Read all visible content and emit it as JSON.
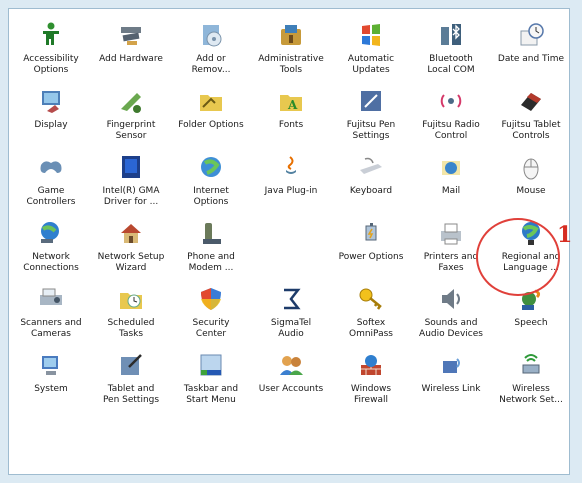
{
  "items": [
    {
      "label": "Accessibility\nOptions",
      "icon": "accessibility-icon"
    },
    {
      "label": "Add Hardware",
      "icon": "add-hardware-icon"
    },
    {
      "label": "Add or\nRemov...",
      "icon": "add-remove-programs-icon"
    },
    {
      "label": "Administrative\nTools",
      "icon": "administrative-tools-icon"
    },
    {
      "label": "Automatic\nUpdates",
      "icon": "automatic-updates-icon"
    },
    {
      "label": "Bluetooth\nLocal COM",
      "icon": "bluetooth-icon"
    },
    {
      "label": "Date and Time",
      "icon": "date-time-icon"
    },
    {
      "label": "Display",
      "icon": "display-icon"
    },
    {
      "label": "Fingerprint\nSensor",
      "icon": "fingerprint-sensor-icon"
    },
    {
      "label": "Folder Options",
      "icon": "folder-options-icon"
    },
    {
      "label": "Fonts",
      "icon": "fonts-icon"
    },
    {
      "label": "Fujitsu Pen\nSettings",
      "icon": "pen-settings-icon"
    },
    {
      "label": "Fujitsu Radio\nControl",
      "icon": "radio-control-icon"
    },
    {
      "label": "Fujitsu Tablet\nControls",
      "icon": "tablet-controls-icon"
    },
    {
      "label": "Game\nControllers",
      "icon": "game-controllers-icon"
    },
    {
      "label": "Intel(R) GMA\nDriver for ...",
      "icon": "intel-gma-icon"
    },
    {
      "label": "Internet\nOptions",
      "icon": "internet-options-icon"
    },
    {
      "label": "Java Plug-in",
      "icon": "java-icon"
    },
    {
      "label": "Keyboard",
      "icon": "keyboard-icon"
    },
    {
      "label": "Mail",
      "icon": "mail-icon"
    },
    {
      "label": "Mouse",
      "icon": "mouse-icon"
    },
    {
      "label": "Network\nConnections",
      "icon": "network-connections-icon"
    },
    {
      "label": "Network Setup\nWizard",
      "icon": "network-setup-icon"
    },
    {
      "label": "Phone and\nModem ...",
      "icon": "phone-modem-icon"
    },
    {
      "label": "",
      "icon": ""
    },
    {
      "label": "Power Options",
      "icon": "power-options-icon"
    },
    {
      "label": "Printers and\nFaxes",
      "icon": "printers-icon"
    },
    {
      "label": "Regional and\nLanguage ...",
      "icon": "regional-language-icon"
    },
    {
      "label": "Scanners and\nCameras",
      "icon": "scanners-icon"
    },
    {
      "label": "Scheduled\nTasks",
      "icon": "scheduled-tasks-icon"
    },
    {
      "label": "Security\nCenter",
      "icon": "security-center-icon"
    },
    {
      "label": "SigmaTel\nAudio",
      "icon": "sigmatel-audio-icon"
    },
    {
      "label": "Softex\nOmniPass",
      "icon": "omnipass-key-icon"
    },
    {
      "label": "Sounds and\nAudio Devices",
      "icon": "sounds-icon"
    },
    {
      "label": "Speech",
      "icon": "speech-icon"
    },
    {
      "label": "System",
      "icon": "system-icon"
    },
    {
      "label": "Tablet and\nPen Settings",
      "icon": "tablet-pen-icon"
    },
    {
      "label": "Taskbar and\nStart Menu",
      "icon": "taskbar-icon"
    },
    {
      "label": "User Accounts",
      "icon": "user-accounts-icon"
    },
    {
      "label": "Windows\nFirewall",
      "icon": "firewall-icon"
    },
    {
      "label": "Wireless Link",
      "icon": "wireless-link-icon"
    },
    {
      "label": "Wireless\nNetwork Set...",
      "icon": "wireless-network-icon"
    }
  ],
  "annotation": {
    "number": "1"
  }
}
